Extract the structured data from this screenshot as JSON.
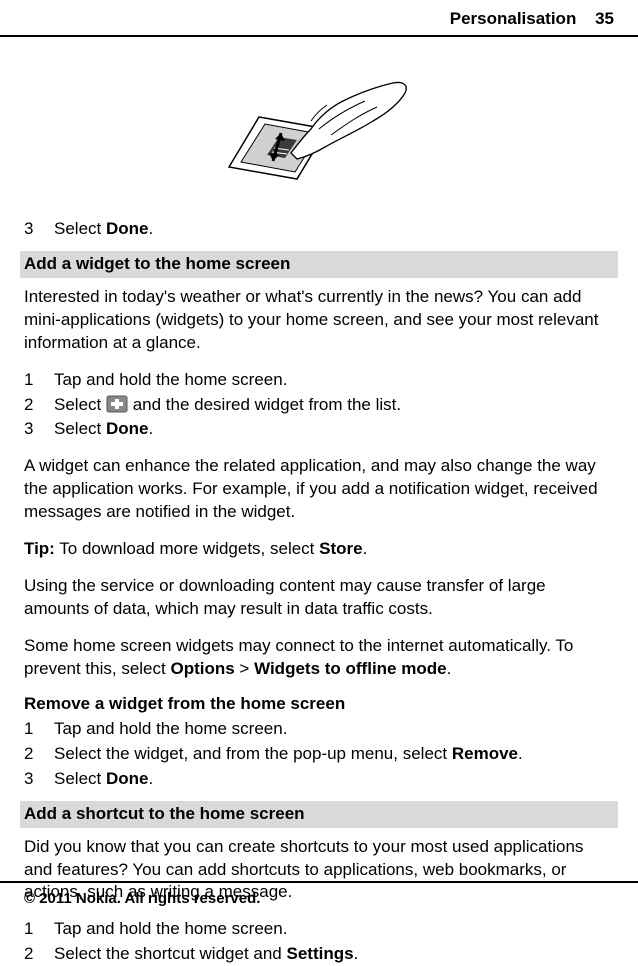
{
  "header": {
    "chapter": "Personalisation",
    "page": "35"
  },
  "top_step": {
    "num": "3",
    "prefix": "Select ",
    "bold": "Done",
    "suffix": "."
  },
  "heading1": "Add a widget to the home screen",
  "paraA": "Interested in today's weather or what's currently in the news? You can add mini-applications (widgets) to your home screen, and see your most relevant information at a glance.",
  "stepsA": [
    {
      "num": "1",
      "prefix": "Tap and hold the home screen.",
      "bold": "",
      "suffix": ""
    },
    {
      "num": "2",
      "prefix": "Select ",
      "icon": true,
      "afterIcon": " and the desired widget from the list."
    },
    {
      "num": "3",
      "prefix": "Select ",
      "bold": "Done",
      "suffix": "."
    }
  ],
  "paraB": "A widget can enhance the related application, and may also change the way the application works. For example, if you add a notification widget, received messages are notified in the widget.",
  "tip": {
    "label": "Tip:",
    "prefix": " To download more widgets, select ",
    "bold": "Store",
    "suffix": "."
  },
  "paraC": "Using the service or downloading content may cause transfer of large amounts of data, which may result in data traffic costs.",
  "paraD": {
    "p1": "Some home screen widgets may connect to the internet automatically. To prevent this, select ",
    "b1": "Options",
    "sep": "  > ",
    "b2": "Widgets to offline mode",
    "suffix": "."
  },
  "heading2": "Remove a widget from the home screen",
  "stepsB": [
    {
      "num": "1",
      "prefix": "Tap and hold the home screen.",
      "bold": "",
      "suffix": ""
    },
    {
      "num": "2",
      "prefix": "Select the widget, and from the pop-up menu, select ",
      "bold": "Remove",
      "suffix": "."
    },
    {
      "num": "3",
      "prefix": "Select ",
      "bold": "Done",
      "suffix": "."
    }
  ],
  "heading3": "Add a shortcut to the home screen",
  "paraE": "Did you know that you can create shortcuts to your most used applications and features? You can add shortcuts to applications, web bookmarks, or actions, such as writing a message.",
  "stepsC": [
    {
      "num": "1",
      "prefix": "Tap and hold the home screen.",
      "bold": "",
      "suffix": ""
    },
    {
      "num": "2",
      "prefix": "Select the shortcut widget and ",
      "bold": "Settings",
      "suffix": "."
    }
  ],
  "footer": "© 2011 Nokia. All rights reserved."
}
